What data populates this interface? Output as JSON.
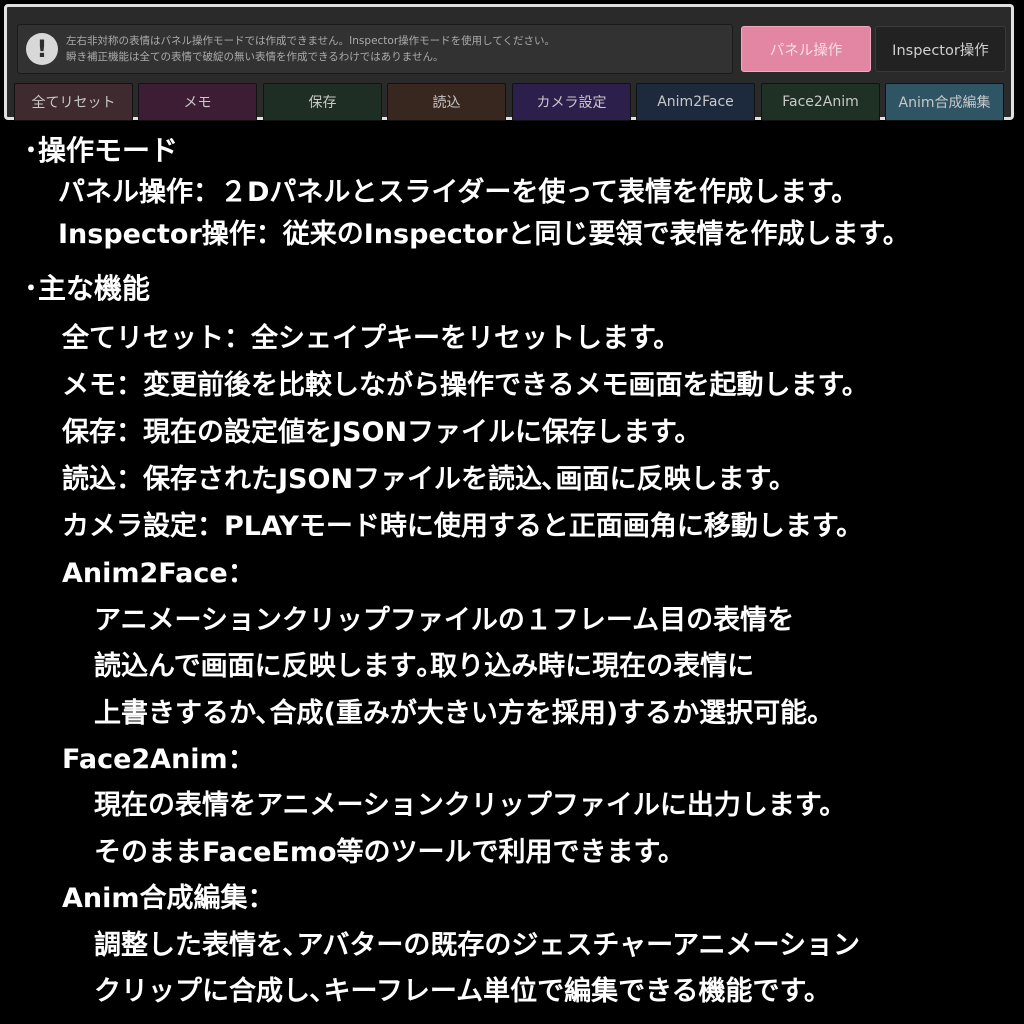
{
  "warning": {
    "icon": "exclamation-icon",
    "line1": "左右非対称の表情はパネル操作モードでは作成できません。Inspector操作モードを使用してください。",
    "line2": "瞬き補正機能は全ての表情で破綻の無い表情を作成できるわけではありません。"
  },
  "mode_buttons": {
    "panel": "パネル操作",
    "inspector": "Inspector操作"
  },
  "function_buttons": [
    {
      "label": "全てリセット",
      "color": "#3e2a2f"
    },
    {
      "label": "メモ",
      "color": "#3c1d33"
    },
    {
      "label": "保存",
      "color": "#1f2e24"
    },
    {
      "label": "読込",
      "color": "#37271f"
    },
    {
      "label": "カメラ設定",
      "color": "#2c1f4c"
    },
    {
      "label": "Anim2Face",
      "color": "#1d2a3d"
    },
    {
      "label": "Face2Anim",
      "color": "#1f3025"
    },
    {
      "label": "Anim合成編集",
      "color": "#2f5464"
    }
  ],
  "text": {
    "mode_heading": "･操作モード",
    "mode_panel": "パネル操作：２Dパネルとスライダーを使って表情を作成します。",
    "mode_inspector": "Inspector操作：従来のInspectorと同じ要領で表情を作成します。",
    "features_heading": "･主な機能",
    "reset": "全てリセット：全シェイプキーをリセットします。",
    "memo": "メモ：変更前後を比較しながら操作できるメモ画面を起動します。",
    "save": "保存：現在の設定値をJSONファイルに保存します。",
    "load": "読込：保存されたJSONファイルを読込､画面に反映します。",
    "camera": "カメラ設定：PLAYモード時に使用すると正面画角に移動します。",
    "anim2face_title": "Anim2Face：",
    "anim2face_1": "アニメーションクリップファイルの１フレーム目の表情を",
    "anim2face_2": "読込んで画面に反映します｡取り込み時に現在の表情に",
    "anim2face_3": "上書きするか､合成(重みが大きい方を採用)するか選択可能。",
    "face2anim_title": "Face2Anim：",
    "face2anim_1": "現在の表情をアニメーションクリップファイルに出力します。",
    "face2anim_2": "そのままFaceEmo等のツールで利用できます。",
    "animedit_title": "Anim合成編集：",
    "animedit_1": "調整した表情を､アバターの既存のジェスチャーアニメーション",
    "animedit_2": "クリップに合成し､キーフレーム単位で編集できる機能です。"
  }
}
